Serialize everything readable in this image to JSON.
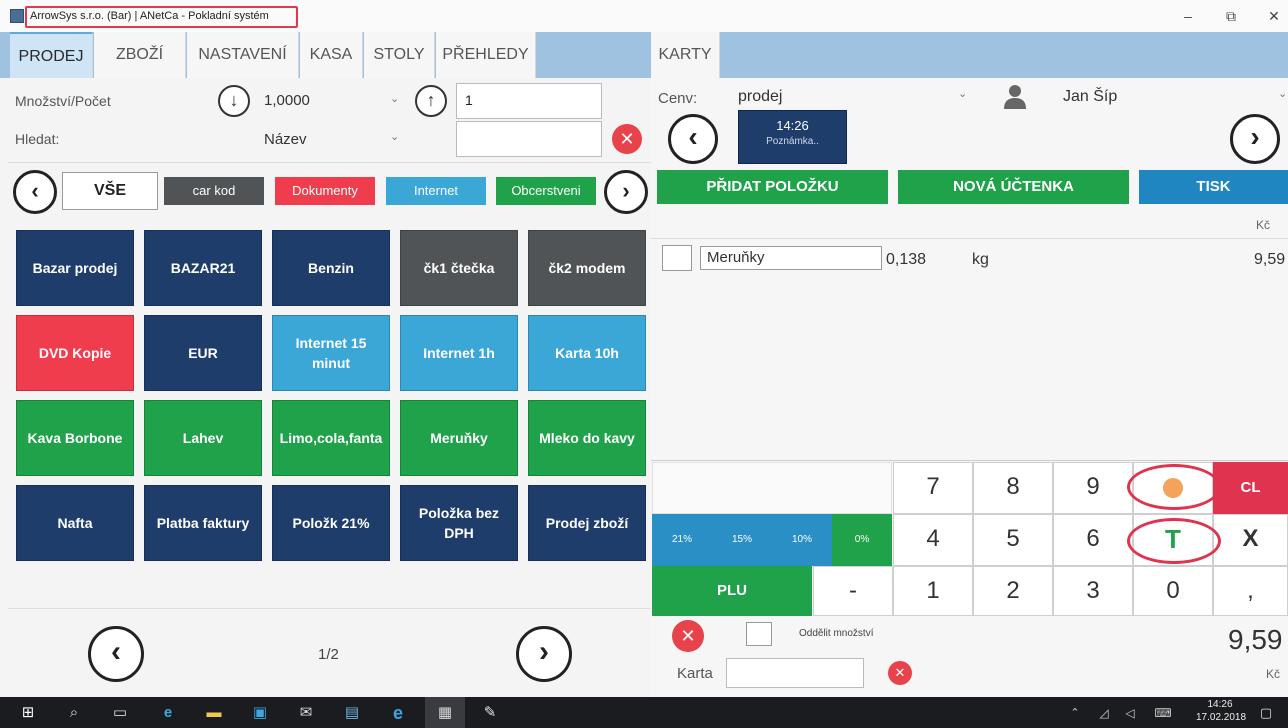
{
  "window": {
    "title": "ArrowSys s.r.o. (Bar) | ANetCa - Pokladní systém",
    "minimize": "–",
    "restore": "⧉",
    "close": "✕"
  },
  "tabs": [
    "PRODEJ",
    "ZBOŽÍ",
    "NASTAVENÍ",
    "KASA",
    "STOLY",
    "PŘEHLEDY",
    "KARTY"
  ],
  "left": {
    "qty_label": "Množství/Počet",
    "qty_value": "1,0000",
    "qty_input": "1",
    "search_label": "Hledat:",
    "search_mode": "Název",
    "search_input": "",
    "categories": [
      "VŠE",
      "car kod",
      "Dokumenty",
      "Internet",
      "Obcerstveni"
    ],
    "tiles": [
      [
        "Bazar prodej",
        "BAZAR21",
        "Benzin",
        "čk1 čtečka",
        "čk2 modem"
      ],
      [
        "DVD Kopie",
        "EUR",
        "Internet 15 minut",
        "Internet 1h",
        "Karta 10h"
      ],
      [
        "Kava Borbone",
        "Lahev",
        "Limo,cola,fanta",
        "Meruňky",
        "Mleko do kavy"
      ],
      [
        "Nafta",
        "Platba faktury",
        "Položk 21%",
        "Položka bez DPH",
        "Prodej zboží"
      ]
    ],
    "page": "1/2"
  },
  "right": {
    "price_list_label": "Cenv:",
    "price_list_value": "prodej",
    "user": "Jan Šíp",
    "note_time": "14:26",
    "note_label": "Poznámka..",
    "add_item": "PŘIDAT POLOŽKU",
    "new_receipt": "NOVÁ ÚČTENKA",
    "print": "TISK",
    "currency": "Kč",
    "items": [
      {
        "name": "Meruňky",
        "qty": "0,138",
        "unit": "kg",
        "price": "9,59"
      }
    ],
    "keypad": {
      "vat": [
        "21%",
        "15%",
        "10%",
        "0%"
      ],
      "plu": "PLU",
      "minus": "-",
      "digits_row1": [
        "7",
        "8",
        "9"
      ],
      "digits_row2": [
        "4",
        "5",
        "6"
      ],
      "digits_row3": [
        "1",
        "2",
        "3",
        "0"
      ],
      "cl": "CL",
      "t": "T",
      "x": "X",
      "comma": ","
    },
    "split_label": "Oddělit množství",
    "total": "9,59",
    "total_currency": "Kč",
    "card_label": "Karta",
    "card_input": ""
  },
  "taskbar": {
    "time": "14:26",
    "date": "17.02.2018"
  },
  "colors": {
    "navy": "#1f3d6b",
    "green": "#1fa24a",
    "light_blue": "#3ba7d6",
    "red": "#f03d4e",
    "print_blue": "#1f86c2"
  }
}
